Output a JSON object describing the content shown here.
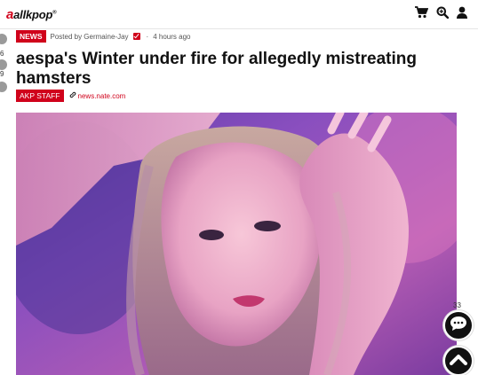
{
  "header": {
    "logo_text": "allkpop",
    "logo_mark": "a",
    "logo_reg": "®",
    "icons": [
      "cart-icon",
      "search-icon",
      "user-icon"
    ]
  },
  "left_rail": {
    "counts": [
      "6",
      "9"
    ]
  },
  "article": {
    "category_badge": "NEWS",
    "posted_by": "Posted by Germaine-Jay",
    "time_ago": "4 hours ago",
    "title_line1": "aespa's Winter under fire for allegedly mistreating",
    "title_line2": "hamsters",
    "staff_badge": "AKP STAFF",
    "source": "news.nate.com"
  },
  "floating": {
    "comment_count": "33",
    "icons": [
      "comment-icon",
      "scroll-top-icon"
    ]
  },
  "colors": {
    "brand_red": "#d0021b",
    "text": "#111111",
    "fab": "#111111"
  }
}
